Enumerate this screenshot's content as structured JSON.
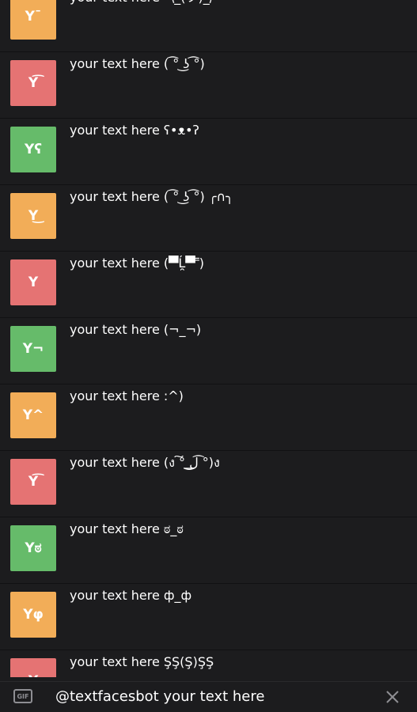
{
  "results": [
    {
      "thumb": "Y¯",
      "color": "#f2ad58",
      "text": "your text here ¯\\_(ツ)_/¯"
    },
    {
      "thumb": "Y͡",
      "color": "#e57373",
      "text": "your text here ( ͡° ͜ʖ ͡°)"
    },
    {
      "thumb": "Yʕ",
      "color": "#66bb6a",
      "text": "your text here ʕ•ᴥ•ʔ"
    },
    {
      "thumb": "Y͜",
      "color": "#f2ad58",
      "text": "your text here ( ͡° ͜ʖ ͡°) ╭∩╮"
    },
    {
      "thumb": "Y",
      "color": "#e57373",
      "text": "your text here (▀̿Ĺ̯▀̿ ̿)"
    },
    {
      "thumb": "Y¬",
      "color": "#66bb6a",
      "text": "your text here (¬_¬)"
    },
    {
      "thumb": "Y^",
      "color": "#f2ad58",
      "text": "your text here :^)"
    },
    {
      "thumb": "Y͡",
      "color": "#e57373",
      "text": "your text here (ง ͠° ͟ل͜ ͡°)ง"
    },
    {
      "thumb": "Yಠ",
      "color": "#66bb6a",
      "text": "your text here ಠ_ಠ"
    },
    {
      "thumb": "Yφ",
      "color": "#f2ad58",
      "text": "your text here ф_ф"
    },
    {
      "thumb": "Y",
      "color": "#e57373",
      "text": "your text here ŞŞ(Ş)ŞŞ"
    }
  ],
  "input": {
    "value": "@textfacesbot your text here",
    "gif_label": "GIF"
  },
  "icons": {
    "gif": "gif-icon",
    "close": "close-icon"
  }
}
